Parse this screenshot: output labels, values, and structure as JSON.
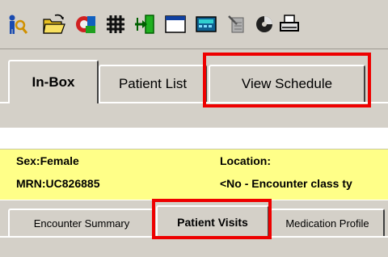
{
  "toolbar": {
    "icons": [
      "find-patient-icon",
      "open-folder-icon",
      "refresh-icon",
      "grid-icon",
      "import-icon",
      "window-icon",
      "calculator-icon",
      "document-edit-icon",
      "chart-icon",
      "print-icon"
    ]
  },
  "top_tabs": {
    "items": [
      {
        "label": "In-Box",
        "active": true
      },
      {
        "label": "Patient List",
        "active": false
      },
      {
        "label": "View Schedule",
        "active": false
      }
    ]
  },
  "patient_banner": {
    "sex": "Sex:Female",
    "location_label": "Location:",
    "mrn": "MRN:UC826885",
    "encounter_class": "<No - Encounter class ty"
  },
  "bottom_tabs": {
    "items": [
      {
        "label": "Encounter Summary",
        "active": false
      },
      {
        "label": "Patient Visits",
        "active": true
      },
      {
        "label": "Medication Profile",
        "active": false
      }
    ]
  },
  "colors": {
    "highlight": "#ee0000",
    "banner": "#ffff88",
    "chrome": "#d4d0c8"
  }
}
